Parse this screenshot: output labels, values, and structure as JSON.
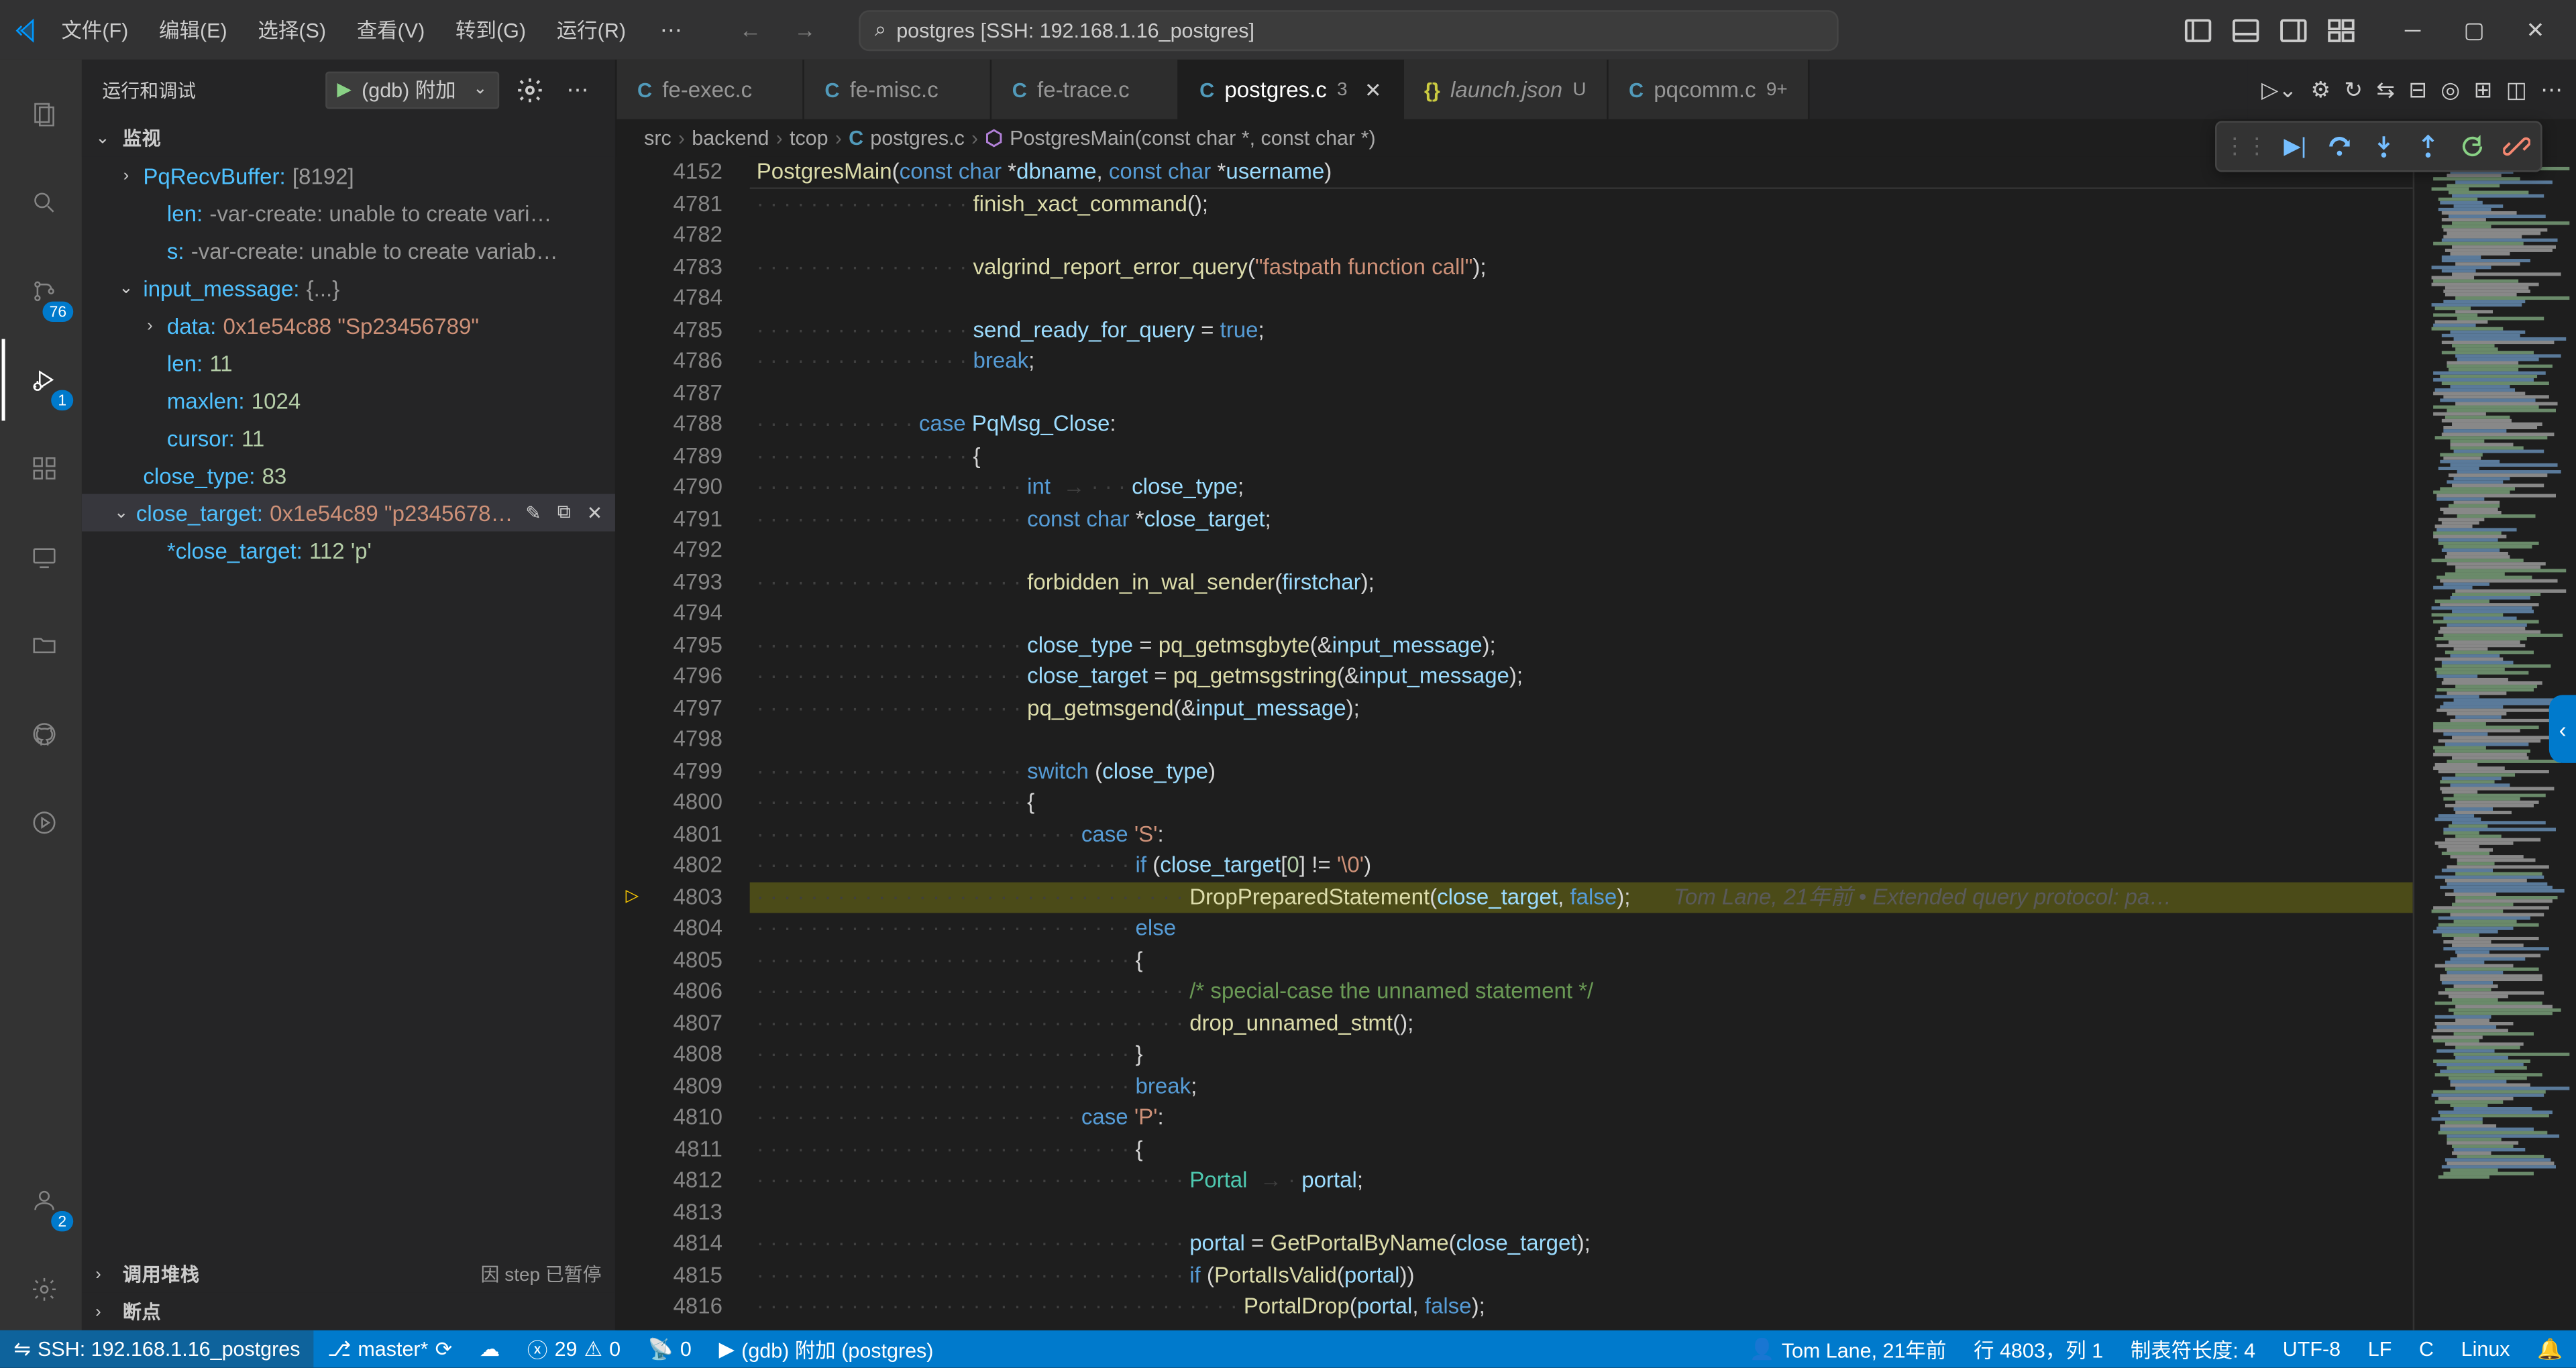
{
  "title": "postgres [SSH: 192.168.1.16_postgres]",
  "menu": [
    "文件(F)",
    "编辑(E)",
    "选择(S)",
    "查看(V)",
    "转到(G)",
    "运行(R)"
  ],
  "search_text": "postgres [SSH: 192.168.1.16_postgres]",
  "activity_badge_scm": "76",
  "activity_badge_debug": "1",
  "activity_badge_account": "2",
  "sidebar": {
    "title": "运行和调试",
    "config": "(gdb) 附加",
    "sections": {
      "watch": "监视",
      "callstack": "调用堆栈",
      "callstack_status": "因 step 已暂停",
      "breakpoints": "断点"
    },
    "watch": [
      {
        "indent": 0,
        "chev": ">",
        "key": "PqRecvBuffer:",
        "val": "[8192]",
        "valcls": "watch-gray"
      },
      {
        "indent": 1,
        "key": "len:",
        "val": "-var-create: unable to create vari…",
        "valcls": "watch-gray"
      },
      {
        "indent": 1,
        "key": "s:",
        "val": "-var-create: unable to create variab…",
        "valcls": "watch-gray"
      },
      {
        "indent": 0,
        "chev": "v",
        "key": "input_message:",
        "val": "{...}",
        "valcls": "watch-gray"
      },
      {
        "indent": 1,
        "chev": ">",
        "key": "data:",
        "val": "0x1e54c88 \"Sp23456789\"",
        "valcls": "watch-val"
      },
      {
        "indent": 1,
        "key": "len:",
        "val": "11",
        "valcls": "watch-num"
      },
      {
        "indent": 1,
        "key": "maxlen:",
        "val": "1024",
        "valcls": "watch-num"
      },
      {
        "indent": 1,
        "key": "cursor:",
        "val": "11",
        "valcls": "watch-num"
      },
      {
        "indent": 0,
        "key": "close_type:",
        "val": "83",
        "valcls": "watch-num"
      },
      {
        "indent": 0,
        "chev": "v",
        "key": "close_target:",
        "val": "0x1e54c89 \"p2345678…",
        "valcls": "watch-val",
        "selected": true,
        "actions": true
      },
      {
        "indent": 1,
        "key": "*close_target:",
        "val": "112 'p'",
        "valcls": "watch-num"
      }
    ]
  },
  "tabs": [
    {
      "icon": "C",
      "name": "fe-exec.c",
      "mod": false
    },
    {
      "icon": "C",
      "name": "fe-misc.c",
      "mod": false
    },
    {
      "icon": "C",
      "name": "fe-trace.c",
      "mod": false
    },
    {
      "icon": "C",
      "name": "postgres.c",
      "badge": "3",
      "close": true,
      "active": true
    },
    {
      "icon": "{}",
      "name": "launch.json",
      "badge": "U",
      "italic": true,
      "json": true
    },
    {
      "icon": "C",
      "name": "pqcomm.c",
      "badge": "9+"
    }
  ],
  "breadcrumb": [
    "src",
    "backend",
    "tcop",
    {
      "icon": "C",
      "text": "postgres.c"
    },
    {
      "icon": "fn",
      "text": "PostgresMain(const char *, const char *)"
    }
  ],
  "sticky_line": {
    "num": "4152",
    "html": "<span class='fn'>PostgresMain</span><span class='op'>(</span><span class='kw'>const</span> <span class='kw'>char</span> <span class='op'>*</span><span class='id'>dbname</span><span class='op'>,</span> <span class='kw'>const</span> <span class='kw'>char</span> <span class='op'>*</span><span class='id'>username</span><span class='op'>)</span>"
  },
  "lines": [
    {
      "n": "4781",
      "t": "<span class='ws'>· · · · · · · · · · · · · · · · </span><span class='fn'>finish_xact_command</span><span class='op'>();</span>"
    },
    {
      "n": "4782",
      "t": ""
    },
    {
      "n": "4783",
      "t": "<span class='ws'>· · · · · · · · · · · · · · · · </span><span class='fn'>valgrind_report_error_query</span><span class='op'>(</span><span class='str'>\"fastpath function call\"</span><span class='op'>);</span>"
    },
    {
      "n": "4784",
      "t": ""
    },
    {
      "n": "4785",
      "t": "<span class='ws'>· · · · · · · · · · · · · · · · </span><span class='id'>send_ready_for_query</span> <span class='op'>=</span> <span class='kw'>true</span><span class='op'>;</span>"
    },
    {
      "n": "4786",
      "t": "<span class='ws'>· · · · · · · · · · · · · · · · </span><span class='kw'>break</span><span class='op'>;</span>"
    },
    {
      "n": "4787",
      "t": ""
    },
    {
      "n": "4788",
      "t": "<span class='ws'>· · · · · · · · · · · · </span><span class='kw'>case</span> <span class='id'>PqMsg_Close</span><span class='op'>:</span>"
    },
    {
      "n": "4789",
      "t": "<span class='ws'>· · · · · · · · · · · · · · · · </span><span class='op'>{</span>"
    },
    {
      "n": "4790",
      "t": "<span class='ws'>· · · · · · · · · · · · · · · · · · · · </span><span class='kw'>int</span><span class='ws'>  → · · · </span><span class='id'>close_type</span><span class='op'>;</span>"
    },
    {
      "n": "4791",
      "t": "<span class='ws'>· · · · · · · · · · · · · · · · · · · · </span><span class='kw'>const</span> <span class='kw'>char</span> <span class='op'>*</span><span class='id'>close_target</span><span class='op'>;</span>"
    },
    {
      "n": "4792",
      "t": ""
    },
    {
      "n": "4793",
      "t": "<span class='ws'>· · · · · · · · · · · · · · · · · · · · </span><span class='fn'>forbidden_in_wal_sender</span><span class='op'>(</span><span class='id'>firstchar</span><span class='op'>);</span>"
    },
    {
      "n": "4794",
      "t": ""
    },
    {
      "n": "4795",
      "t": "<span class='ws'>· · · · · · · · · · · · · · · · · · · · </span><span class='id'>close_type</span> <span class='op'>=</span> <span class='fn'>pq_getmsgbyte</span><span class='op'>(&amp;</span><span class='id'>input_message</span><span class='op'>);</span>"
    },
    {
      "n": "4796",
      "t": "<span class='ws'>· · · · · · · · · · · · · · · · · · · · </span><span class='id'>close_target</span> <span class='op'>=</span> <span class='fn'>pq_getmsgstring</span><span class='op'>(&amp;</span><span class='id'>input_message</span><span class='op'>);</span>"
    },
    {
      "n": "4797",
      "t": "<span class='ws'>· · · · · · · · · · · · · · · · · · · · </span><span class='fn'>pq_getmsgend</span><span class='op'>(&amp;</span><span class='id'>input_message</span><span class='op'>);</span>"
    },
    {
      "n": "4798",
      "t": ""
    },
    {
      "n": "4799",
      "t": "<span class='ws'>· · · · · · · · · · · · · · · · · · · · </span><span class='kw'>switch</span> <span class='op'>(</span><span class='id'>close_type</span><span class='op'>)</span>"
    },
    {
      "n": "4800",
      "t": "<span class='ws'>· · · · · · · · · · · · · · · · · · · · </span><span class='op'>{</span>"
    },
    {
      "n": "4801",
      "t": "<span class='ws'>· · · · · · · · · · · · · · · · · · · · · · · · </span><span class='kw'>case</span> <span class='str'>'S'</span><span class='op'>:</span>"
    },
    {
      "n": "4802",
      "t": "<span class='ws'>· · · · · · · · · · · · · · · · · · · · · · · · · · · · </span><span class='kw'>if</span> <span class='op'>(</span><span class='id'>close_target</span><span class='op'>[</span><span class='num'>0</span><span class='op'>]</span> <span class='op'>!=</span> <span class='str'>'\\0'</span><span class='op'>)</span>"
    },
    {
      "n": "4803",
      "t": "<span class='ws'>· · · · · · · · · · · · · · · · · · · · · · · · · · · · · · · · </span><span class='fn'>DropPreparedStatement</span><span class='op'>(</span><span class='id'>close_target</span><span class='op'>,</span> <span class='kw'>false</span><span class='op'>);</span>       <span class='blame'>Tom Lane, 21年前 • Extended query protocol: pa…</span>",
      "current": true,
      "glyph": "arrow"
    },
    {
      "n": "4804",
      "t": "<span class='ws'>· · · · · · · · · · · · · · · · · · · · · · · · · · · · </span><span class='kw'>else</span>"
    },
    {
      "n": "4805",
      "t": "<span class='ws'>· · · · · · · · · · · · · · · · · · · · · · · · · · · · </span><span class='op'>{</span>"
    },
    {
      "n": "4806",
      "t": "<span class='ws'>· · · · · · · · · · · · · · · · · · · · · · · · · · · · · · · · </span><span class='cm'>/* special-case the unnamed statement */</span>"
    },
    {
      "n": "4807",
      "t": "<span class='ws'>· · · · · · · · · · · · · · · · · · · · · · · · · · · · · · · · </span><span class='fn'>drop_unnamed_stmt</span><span class='op'>();</span>"
    },
    {
      "n": "4808",
      "t": "<span class='ws'>· · · · · · · · · · · · · · · · · · · · · · · · · · · · </span><span class='op'>}</span>"
    },
    {
      "n": "4809",
      "t": "<span class='ws'>· · · · · · · · · · · · · · · · · · · · · · · · · · · · </span><span class='kw'>break</span><span class='op'>;</span>"
    },
    {
      "n": "4810",
      "t": "<span class='ws'>· · · · · · · · · · · · · · · · · · · · · · · · </span><span class='kw'>case</span> <span class='str'>'P'</span><span class='op'>:</span>"
    },
    {
      "n": "4811",
      "t": "<span class='ws'>· · · · · · · · · · · · · · · · · · · · · · · · · · · · </span><span class='op'>{</span>"
    },
    {
      "n": "4812",
      "t": "<span class='ws'>· · · · · · · · · · · · · · · · · · · · · · · · · · · · · · · · </span><span class='ty'>Portal</span><span class='ws'>  → · </span><span class='id'>portal</span><span class='op'>;</span>"
    },
    {
      "n": "4813",
      "t": ""
    },
    {
      "n": "4814",
      "t": "<span class='ws'>· · · · · · · · · · · · · · · · · · · · · · · · · · · · · · · · </span><span class='id'>portal</span> <span class='op'>=</span> <span class='fn'>GetPortalByName</span><span class='op'>(</span><span class='id'>close_target</span><span class='op'>);</span>"
    },
    {
      "n": "4815",
      "t": "<span class='ws'>· · · · · · · · · · · · · · · · · · · · · · · · · · · · · · · · </span><span class='kw'>if</span> <span class='op'>(</span><span class='fn'>PortalIsValid</span><span class='op'>(</span><span class='id'>portal</span><span class='op'>))</span>"
    },
    {
      "n": "4816",
      "t": "<span class='ws'>· · · · · · · · · · · · · · · · · · · · · · · · · · · · · · · · · · · · </span><span class='fn'>PortalDrop</span><span class='op'>(</span><span class='id'>portal</span><span class='op'>,</span> <span class='kw'>false</span><span class='op'>);</span>"
    }
  ],
  "statusbar": {
    "remote": "SSH: 192.168.1.16_postgres",
    "branch": "master*",
    "errors": "29",
    "warnings": "0",
    "ports": "0",
    "debug": "(gdb) 附加 (postgres)",
    "blame": "Tom Lane, 21年前",
    "line": "行 4803，列 1",
    "tabsize": "制表符长度: 4",
    "encoding": "UTF-8",
    "eol": "LF",
    "lang": "C",
    "os": "Linux"
  }
}
